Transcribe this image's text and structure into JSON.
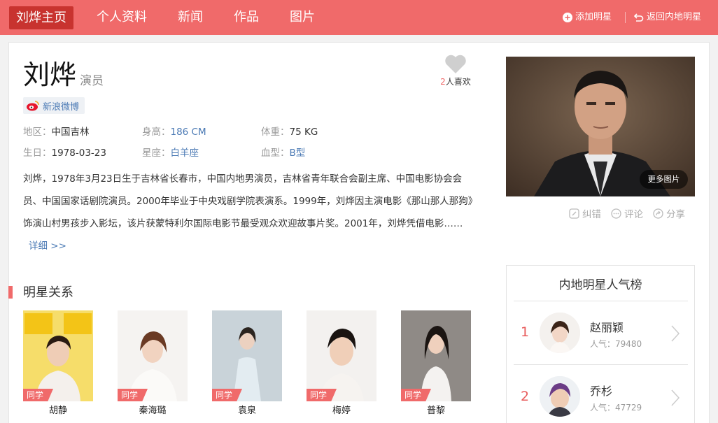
{
  "nav": {
    "brand": "刘烨主页",
    "links": [
      "个人资料",
      "新闻",
      "作品",
      "图片"
    ],
    "add_star": "添加明星",
    "back": "返回内地明星"
  },
  "profile": {
    "name": "刘烨",
    "role": "演员",
    "likes_count": "2",
    "likes_suffix": "人喜欢",
    "weibo": "新浪微博",
    "region_label": "地区：",
    "region": "中国吉林",
    "height_label": "身高：",
    "height": "186 CM",
    "weight_label": "体重：",
    "weight": "75 KG",
    "birthday_label": "生日：",
    "birthday": "1978-03-23",
    "zodiac_label": "星座：",
    "zodiac": "白羊座",
    "blood_label": "血型：",
    "blood": "B型",
    "bio": "刘烨，1978年3月23日生于吉林省长春市，中国内地男演员，吉林省青年联合会副主席、中国电影协会会员、中国国家话剧院演员。2000年毕业于中央戏剧学院表演系。1999年，刘烨因主演电影《那山那人那狗》饰演山村男孩步入影坛，该片获蒙特利尔国际电影节最受观众欢迎故事片奖。2001年，刘烨凭借电影……",
    "more": "详细 >>"
  },
  "photo": {
    "more_pics": "更多图片"
  },
  "actions": {
    "correct": "纠错",
    "comment": "评论",
    "share": "分享"
  },
  "relations": {
    "title": "明星关系",
    "items": [
      {
        "tag": "同学",
        "name": "胡静"
      },
      {
        "tag": "同学",
        "name": "秦海璐"
      },
      {
        "tag": "同学",
        "name": "袁泉"
      },
      {
        "tag": "同学",
        "name": "梅婷"
      },
      {
        "tag": "同学",
        "name": "普黎"
      }
    ]
  },
  "ranking": {
    "title": "内地明星人气榜",
    "items": [
      {
        "rank": "1",
        "name": "赵丽颖",
        "popularity": "人气：79480"
      },
      {
        "rank": "2",
        "name": "乔杉",
        "popularity": "人气：47729"
      }
    ]
  },
  "colors": {
    "accent": "#f06a6a",
    "brand_bg": "#c8332f",
    "link_blue": "#4a79b4"
  }
}
